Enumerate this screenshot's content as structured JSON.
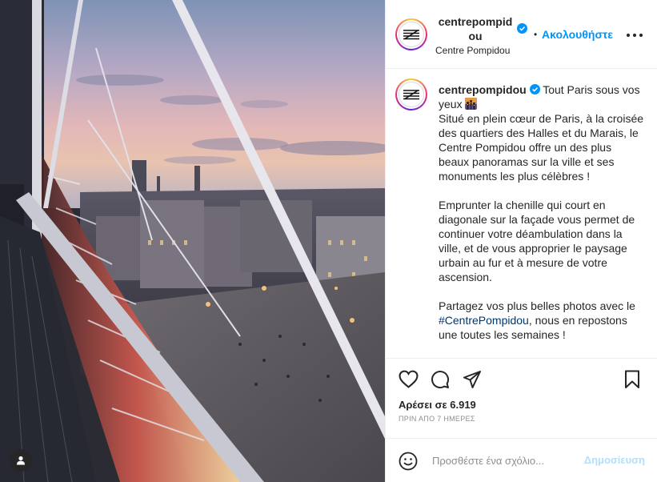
{
  "header": {
    "username": "centrepompidou",
    "verified": true,
    "separator": "•",
    "follow_label": "Ακολουθήστε",
    "location": "Centre Pompidou"
  },
  "caption": {
    "username": "centrepompidou",
    "title": "Tout Paris sous vos yeux",
    "title_emoji": "cityscape-at-dusk-emoji",
    "paragraph1": "Situé en plein cœur de Paris, à la croisée des quartiers des Halles et du Marais, le Centre Pompidou offre un des plus beaux panoramas sur la ville et ses monuments les plus célèbres !",
    "paragraph2": "Emprunter la chenille qui court en diagonale sur la façade vous permet de continuer votre déambulation dans la ville, et de vous approprier le paysage urbain au fur et à mesure de votre ascension.",
    "paragraph3_before": "Partagez vos plus belles photos avec le ",
    "hashtag": "#CentrePompidou",
    "paragraph3_after": ", nous en repostons une toutes les semaines !"
  },
  "actions": {
    "icons": [
      "heart-icon",
      "comment-icon",
      "share-icon",
      "bookmark-icon"
    ],
    "likes_label": "Αρέσει σε 6.919",
    "timestamp": "ΠΡΙΝ ΑΠΟ 7 ΗΜΕΡΕΣ"
  },
  "comment": {
    "placeholder": "Προσθέστε ένα σχόλιο...",
    "post_label": "Δημοσίευση"
  },
  "photo": {
    "description_icon": "user-tag-icon"
  },
  "colors": {
    "accent": "#0095f6",
    "hashtag": "#00376b",
    "post_disabled": "#b2dffc",
    "muted": "#8e8e8e"
  }
}
